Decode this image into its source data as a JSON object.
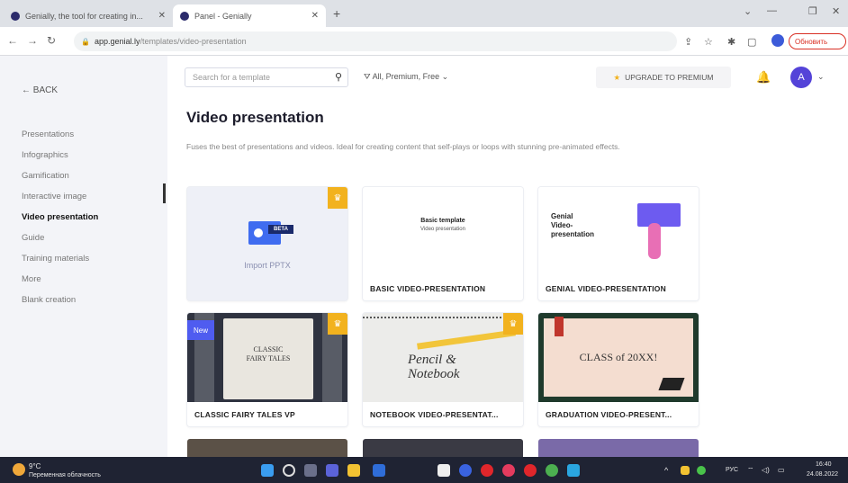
{
  "browser": {
    "tabs": [
      {
        "title": "Genially, the tool for creating in...",
        "active": false
      },
      {
        "title": "Panel - Genially",
        "active": true
      }
    ],
    "url_host": "app.genial.ly",
    "url_path": "/templates/video-presentation",
    "profile_label": "Обновить"
  },
  "sidebar": {
    "back_label": "BACK",
    "items": [
      {
        "label": "Presentations"
      },
      {
        "label": "Infographics"
      },
      {
        "label": "Gamification"
      },
      {
        "label": "Interactive image"
      },
      {
        "label": "Video presentation",
        "active": true
      },
      {
        "label": "Guide"
      },
      {
        "label": "Training materials"
      },
      {
        "label": "More"
      },
      {
        "label": "Blank creation"
      }
    ]
  },
  "toolbar": {
    "search_placeholder": "Search for a template",
    "filter_label": "All, Premium, Free",
    "upgrade_label": "UPGRADE TO PREMIUM",
    "avatar_letter": "A"
  },
  "page": {
    "title": "Video presentation",
    "description": "Fuses the best of presentations and videos. Ideal for creating content that self-plays or loops with stunning pre-animated effects."
  },
  "cards": [
    {
      "label": "",
      "thumb_text": "Import PPTX",
      "badge": "BETA",
      "premium": true
    },
    {
      "label": "BASIC VIDEO-PRESENTATION",
      "thumb_line1": "Basic template",
      "thumb_line2": "Video presentation"
    },
    {
      "label": "GENIAL VIDEO-PRESENTATION",
      "thumb_line1": "Genial",
      "thumb_line2": "Video-",
      "thumb_line3": "presentation"
    },
    {
      "label": "CLASSIC FAIRY TALES VP",
      "thumb_line1": "CLASSIC",
      "thumb_line2": "FAIRY TALES",
      "badge": "New",
      "premium": true
    },
    {
      "label": "NOTEBOOK VIDEO-PRESENTAT...",
      "thumb_line1": "Pencil &",
      "thumb_line2": "Notebook",
      "premium": true
    },
    {
      "label": "GRADUATION VIDEO-PRESENT...",
      "thumb_line1": "CLASS of 20XX!"
    }
  ],
  "taskbar": {
    "weather_temp": "9°C",
    "weather_desc": "Переменная облачность",
    "lang": "РУС",
    "time": "16:40",
    "date": "24.08.2022"
  },
  "colors": {
    "accent": "#5443d8",
    "premium": "#f2b21e",
    "new_badge": "#4f5cf0"
  }
}
